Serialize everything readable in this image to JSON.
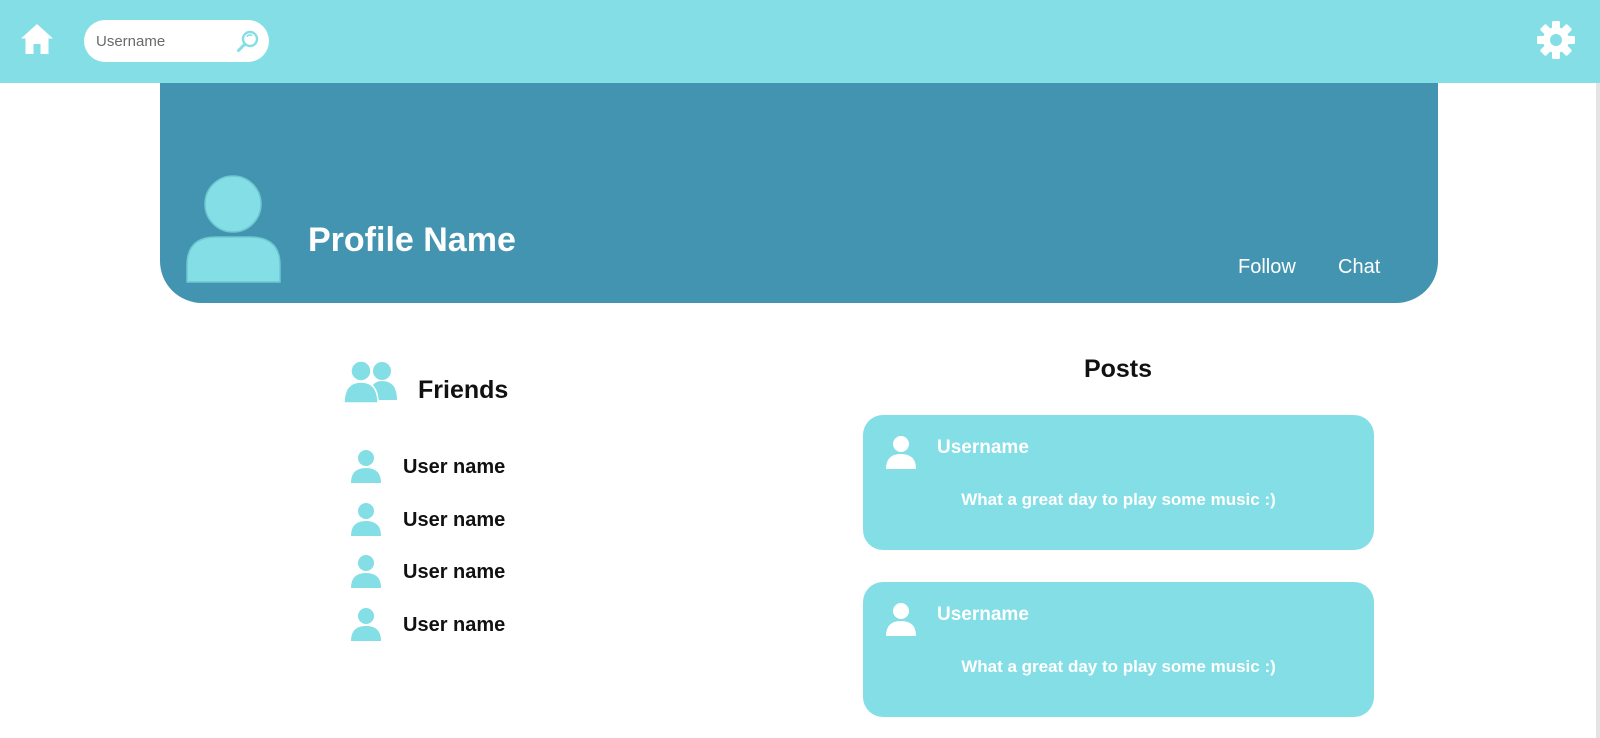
{
  "colors": {
    "topbar": "#83dee6",
    "banner": "#4294b0",
    "accent": "#83dee6",
    "text_dark": "#111111",
    "text_light": "#ffffff"
  },
  "topbar": {
    "home_icon": "home-icon",
    "search": {
      "placeholder": "Username",
      "value": "",
      "icon": "search-icon"
    },
    "settings_icon": "gear-icon"
  },
  "profile": {
    "name": "Profile Name",
    "avatar_icon": "user-avatar-icon",
    "follow_label": "Follow",
    "chat_label": "Chat"
  },
  "friends": {
    "title": "Friends",
    "icon": "friends-icon",
    "items": [
      {
        "name": "User name"
      },
      {
        "name": "User name"
      },
      {
        "name": "User name"
      },
      {
        "name": "User name"
      }
    ]
  },
  "posts": {
    "title": "Posts",
    "items": [
      {
        "username": "Username",
        "text": "What a great day to play some music :)"
      },
      {
        "username": "Username",
        "text": "What a great day to play some music :)"
      }
    ]
  }
}
